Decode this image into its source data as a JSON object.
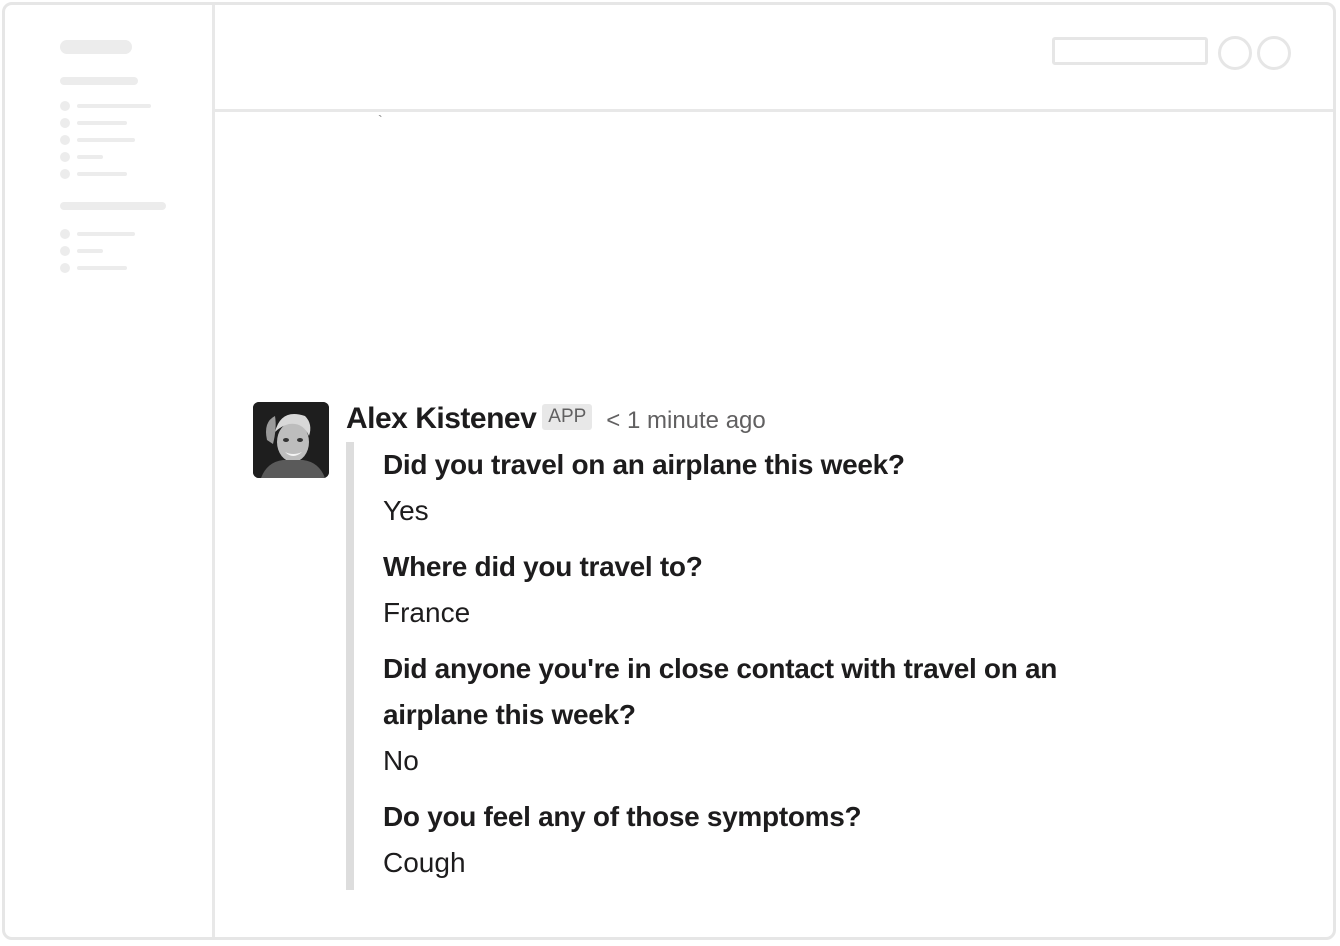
{
  "message": {
    "sender": "Alex Kistenev",
    "badge": "APP",
    "timestamp": "< 1 minute ago",
    "avatar_icon": "user-avatar-photo",
    "fields": [
      {
        "question": "Did you travel on an airplane this week?",
        "answer": "Yes"
      },
      {
        "question": "Where did you travel to?",
        "answer": "France"
      },
      {
        "question": "Did anyone you're in close contact with travel on an airplane this week?",
        "answer": "No"
      },
      {
        "question": "Do you feel any of those symptoms?",
        "answer": "Cough"
      }
    ]
  },
  "colors": {
    "skeleton": "#ececec",
    "border": "#e6e6e6",
    "accent_bar": "#dddddd",
    "text": "#1d1c1d",
    "muted": "#616061"
  }
}
